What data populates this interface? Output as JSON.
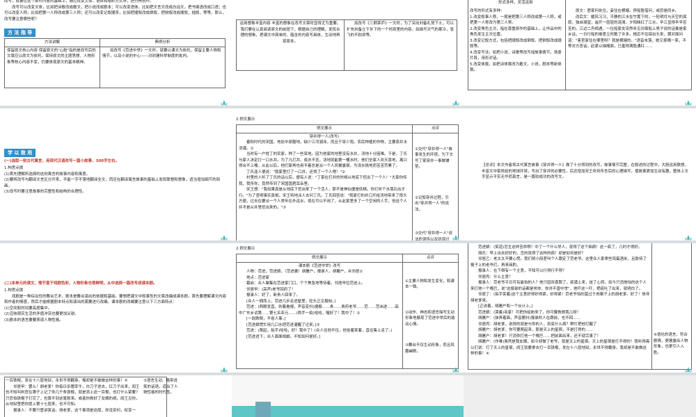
{
  "s1": {
    "top_text": "改写，就要在这个部件内容的基础上，通过改变文体、语体和组织方式等，进行再创作。\n　　改写可以改变文体，比如把诗歌改成散文，把小说改成剧本；可以改变语体，比如把文言文改成白话文，把书面语改成口语；也可以改变人称，比如把第一人称改成第三人称；还可以改变记叙顺序，比如把顺叙改成倒叙，把侧叙改成顺叙，插叙，等等。那么，改写要注意哪些呢？",
    "banner": "方 法 指 导",
    "col1": "方法讲解",
    "col2": "典例分析",
    "method": "保留原文核心内容\n保留原文的\"心脏\"指的是改写后的文章应以原文为依托，保持原文的主题思想、人物形象等核心内容不变，仍要体现原文的基本精神。",
    "example": "　　如改写《范进中举》一文时，就要以课文为依托，保留主要人物和情节，以及小说的中心——对封建科举制度的批判。"
  },
  "s2": {
    "row_left": "运用想象丰富内容\n丰富的想象在改写文章时显得尤为重要。我们要在认真阅读原文的前提下，根据自己的理解，发挥合理的想象，把课文中简单的、蕴含的内容写具体，生动地再现原本。",
    "row_right": "　　如改写《三顾茅庐》一文时，为了突出刘备礼贤下士，可以扩充刘备立于孙下的一个时辰里的内容，如描写天气的寒冷，张飞的不耐烦等。"
  },
  "s3": {
    "head": "形式多样，灵活运用",
    "list": "改写的形式有多种：\n1.改变叙事人称，一般是把第三人称改成第一人称，或把第一人称改为第三人称。\n2.改变角色主次，指在尊重原作的基础上，让作品中的角色发生主次位置。\n3.改变记叙方式，包括把顺叙改成倒叙，把倒叙改成顺叙等。\n4.改变写法，如把小说，诗歌等改写成故事情节，场景片段，用形对话。\n5.改变体裁，如把诗体裁改为散文，小说，剧本等新体裁。",
    "right": "　　原文：君家何处住，妾住在横塘。停船暂借问，或恐是同乡。\n　　改后文：暖风习习，平静的江水在竹篙下的，一轮明月与天空的孤寂，独自凝望，遥开一层层的涟漪，夕阳映红了江水，辛江显得辛辛苦苦的。江边二舟相遇，一位船家女突然听见对面船上男子说的话像是家乡话，一日行船的倦意立时散了许多。她忍不住探出头来，朝对面问道：\"客官家住在哪里呀？我是横塘的。\"语音未落，她又抿嘴一笑，不等对方答话，赶紧以袖掩面，已羞得满脸通红……"
  },
  "s4": {
    "banner": "学 以 致 用",
    "task": "(一)选取一则古代寓言，用现代汉语改写一篇小故事，300字左右。",
    "points": "1.构思点拨\n(1)首先理解所选择的这则寓言的故事内容和寓意。\n(2)要将改写与翻译文言区分开来，不能一字不落地翻译全文，而应在翻译寓言故事的基础上发挥联想和想象，适当增加细节的刻画。\n(3)改写时要注意故事的完整性和结构的合理性。"
  },
  "s5": {
    "caption": "2.例文展示",
    "col1": "例文展示",
    "col2": "点评",
    "title": "穿井得一人(改写)",
    "body": "　　春秋时代的宋国，地处中原腹地，缺少江河湖泽，而且干旱少雨。农民种植的作物，主要靠井水浇灌。①\n　　当时有一户姓丁的农家，种了一些旱地。因为他家的地里没有水井，浇地十分困难。于是，丁氏与家人决定打一口水井。为了凡打井，成亦不苦，浇地就能第一桶水时，他们全家人欢天喜地，离兴得合不上嘴。从此以后，他们家再也用不着总是派一个人风餐露宿，为浇水挑地而苦苦劳累了。\n　　丁氏逢人便说：\"我家里打了一口井，还得了一个人哩！\"②\n　　村里的人听了丁氏的话以后，便有人说：\"丁家在打井的时候从地底下挖出了一个人！\"大家你传我，我传你，竟然传到了宋国国君耳朵里。\n　　宋王想：\"我如果真是从地底下挖出来了一个活人，那不是神仙便是妖精。你打听个水落石出才行。\"为了查明事实真相，宋王特地派人去问丁氏。丁氏回答说：\"我家打的井口开给浇地带来了很大方便，过去在要派一个人常年在外运水，现在可以不用了，从此家里多了一个空闲的人手，但这个人并不是从井里挖出来的。\"③",
    "c1": "①交代\"穿井得一人\"故事发生的环境，为下文写丁家穿井一事做铺垫。",
    "c2": "②记叙穿井过程，引出\"穿井得一人\"的说法。",
    "c3": "③交代\"穿井得一人\"说法的误传以及劝误过程。"
  },
  "s6": {
    "text": "【总评】本文作者将古代寓言故事《穿井得一人》做了十分得到的改写，故事情节完整，在叙述的过程中，大胆运用联想，丰富文中家抢给的地球环境，写出了穿井的必要性，后还增加宋王听到传言后的心理描写，使故事更加生动有趣，整体上文字显示平实无华而真言，是一篇较成功的改写文。"
  },
  "s7": {
    "task": "(二)本单元的课文、情节富于戏剧色彩、人物形象也很鲜明，从中选择一篇改写成课本剧。",
    "points": "1.构思点拨\n　　戏剧是一种综合性的舞台艺术，剧本是舞台演出的依据和基础。要想把课文中叙事性的文章改编成课本剧，首先要理解课文内容和作者的情感，然后才能根据剧本特点和演出的需要进行改编。课本剧的改编要注意以下三方面特点：\n(1)空间和时间要高度集中。\n(2)豆映观实生活的矛盾冲突也要更加尖锐。\n(3)剧本的语言要要表现人物性格。"
  },
  "s8": {
    "caption": "2.例文展示",
    "col1": "例文展示",
    "col2": "点评",
    "title": "课本剧《范进中举》改写",
    "body": "　　人物：范进，范进娘，（范进妻）胡屠户，报录人，胡撇户，众邻居①\n　　地点：范进家\n　　幕启：众人聚集在范进家门口，个个焦急地等待着。邻居甲拉范进上。\n　　邻居甲：(高声)老爷回府了！\n　　报录人：好了，新贵人回来了。\n　　[众人一拥而上，范进几步走进屋里，轮头正见报帖。]\n　　范进：(两眼发直，则着看报，声音变抖)捷报……贵……贵府老爷……范……范讳进……高中广东乡试第……第七名亚元……(两手一拍)哈哈，喔好了！我中了！②\n　　[一跤跌倒，不省人事。]\n　　[范进娘慌忙用几口水把范进灌醒了过来。]③\n　　范进：(爬起，拍手)哈哈，好！我中了！(众人往他不住，他拾着笑着，直往集上走了。)\n　　[范进进下，众人面面相觑，不知如何是好。]",
    "c1": "①主要人物和发生变化，和课本一致。",
    "c2": "②动作、神态和语言描写生动形象地展现了范进中举后的激动心情。",
    "c3": "③舞台不仅生动形象，而且风趣幽默。"
  },
  "s9": {
    "body": "　　范进娘：(笑道)怎生这样苦命啊！中了一个什么举人，就得了这个拙病！这一疯了，几时才得好。\n　　胡氏：早上出去好好的，怎的就得了这样的病！却是如何是好？\n　　邻居乙：老太太不要心慌。我们将小段差叫个人跟定了范老爷。这里众人家拿些鸡蛋酒米，且款待了报子上的老爷们，再来商酌。\n　　报录人：在下倒有一个主意，不知可以行得行不得？\n　　邻居丙：什么主意？\n　　报录人：范老爷平日可有最怕的人？他只因欢喜狠了，痰涌上来，迷了心窍。如今只消他怕的这个人来打他一个嘴巴，说\"这报录的话都是哄你，你并不曾中举\"，他吓这一吓，把痰吐了出来，就明白了。\n　　邻居丁：(拍手笑着)这个主意好得妙得紧，妙得紧！范老爷怕的莫过于肉案子上的胡老爹。好了！快寻胡老爹来。\n　　[正说着，胡屠户和一个伙计上。]\n　　范进娘：(哭着)亲家！可把你给盼来了，你可要救救我儿呀！\n　　胡屠户：(抹弄着面，声音颤抖)报录的人在跟前，也不回……\n　　邻居丙：胡老爹，说得的就是与你的人，到底什么病？帮忙把他打醒了\n　　胡屠户：胡老爹，你可要爬起来，那是天上的星宿，不是打得的……\n　　胡屠户：胡老爹！只消你打他一个嘴巴……把前面出来，还不就完事了！\n　　胡屠户：(作难)虽然是我女婿，如今却做了老爷，就是天上的星宿。天上的星宿是打不得的！我听得斋公们说：打了天上的星宿，阎王就要拿去打一百铁棍，发在十八层地狱，永世不得翻身。我却是不敢做这样的事！④",
    "c4": "④语化的语言，符合剧情，更展露出人物形象，也更引人入胜。"
  },
  "s10": {
    "body": "一百铁棍，发在十八层地狱，永世不得翻身。俺却是不敢做这样的事！⑤\n　　邻居甲：罢么！胡老爹！你每日杀猪宰牛，白刀子进去，红刀子出来，阎王也不知叫判官在簿子上记了你几千条铁棍，就是添上这一百棍，也打什么紧要？只恐怕铁棍子打完了，也算不到这笔账来。或者你救好了女婿的病，阎王见你，从地狱里把你提上第十七层来，也不可知。\n　　报录人：不要只管讲笑话。胡老爹，这个事须是这般，你没奈何，权变一",
    "c5": "⑤语言生动、略带说笑的话语，道出了人物性格的时代性。"
  }
}
